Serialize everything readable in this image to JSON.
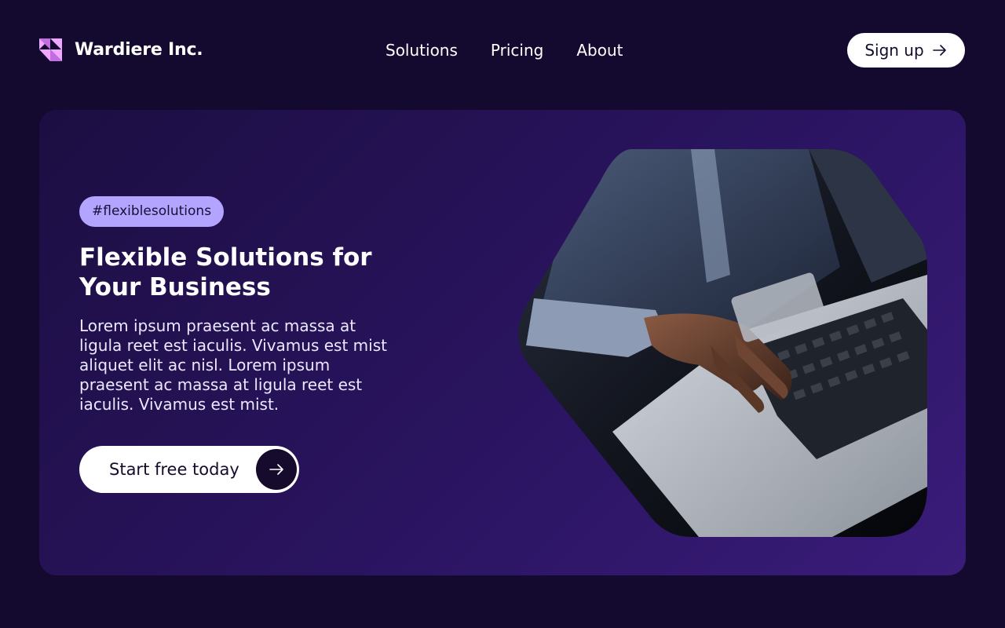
{
  "brand": {
    "name": "Wardiere Inc.",
    "logo_icon": "triangle-mark-icon",
    "logo_color": "#f0a7ff"
  },
  "nav": {
    "items": [
      {
        "label": "Solutions"
      },
      {
        "label": "Pricing"
      },
      {
        "label": "About"
      }
    ]
  },
  "header": {
    "signup_label": "Sign up",
    "signup_icon": "arrow-right-icon"
  },
  "hero": {
    "tag": "#flexiblesolutions",
    "title": "Flexible Solutions for Your Business",
    "body": "Lorem ipsum praesent ac massa at ligula reet est iaculis. Vivamus est mist aliquet elit ac nisl. Lorem ipsum praesent ac massa at ligula reet est iaculis. Vivamus est mist.",
    "cta_label": "Start free today",
    "cta_icon": "arrow-right-icon",
    "image_subject": "hands-typing-on-laptop-image"
  },
  "colors": {
    "page_background": "#140a30",
    "hero_gradient_start": "#1c0e42",
    "hero_gradient_end": "#3a1c7a",
    "tag_background": "#b3a4ff",
    "button_background": "#ffffff",
    "button_text": "#160b2c"
  }
}
